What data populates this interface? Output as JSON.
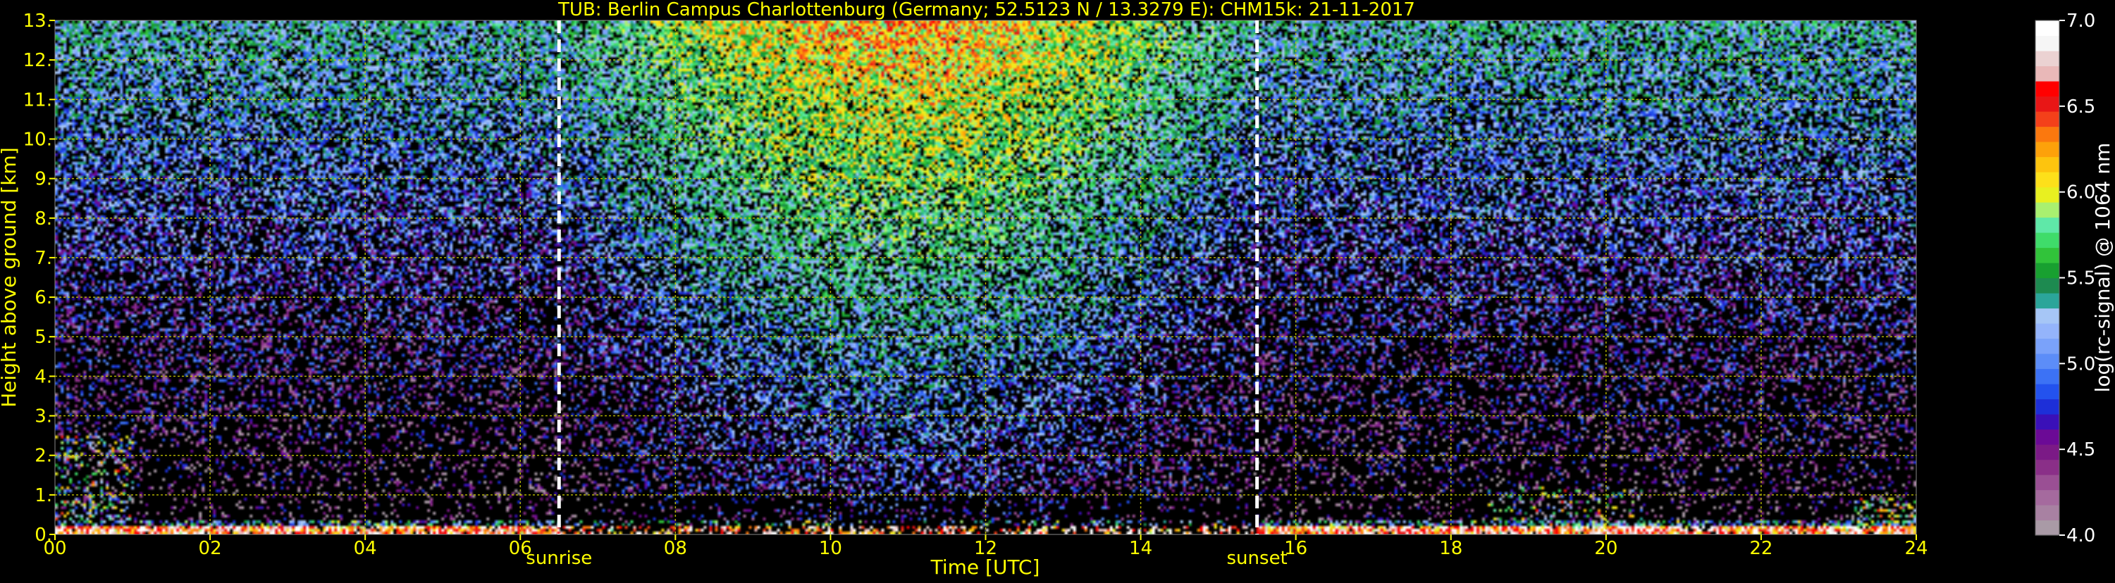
{
  "chart_data": {
    "type": "heatmap",
    "title": "TUB: Berlin Campus Charlottenburg (Germany; 52.5123 N / 13.3279 E):    CHM15k: 21-11-2017",
    "xlabel": "Time [UTC]",
    "ylabel": "Height above ground [km]",
    "xlim": [
      0,
      24
    ],
    "ylim": [
      0,
      13
    ],
    "x_ticks": [
      "00",
      "02",
      "04",
      "06",
      "08",
      "10",
      "12",
      "14",
      "16",
      "18",
      "20",
      "22",
      "24"
    ],
    "x_tick_values": [
      0,
      2,
      4,
      6,
      8,
      10,
      12,
      14,
      16,
      18,
      20,
      22,
      24
    ],
    "y_ticks": [
      "0.",
      "1.",
      "2.",
      "3.",
      "4.",
      "5.",
      "6.",
      "7.",
      "8.",
      "9.",
      "10.",
      "11.",
      "12.",
      "13."
    ],
    "y_tick_values": [
      0,
      1,
      2,
      3,
      4,
      5,
      6,
      7,
      8,
      9,
      10,
      11,
      12,
      13
    ],
    "grid": true,
    "annotations": [
      {
        "label": "sunrise",
        "x": 6.5
      },
      {
        "label": "sunset",
        "x": 15.5
      }
    ],
    "colorbar": {
      "label": "log(rc-signal) @ 1064 nm",
      "range": [
        4.0,
        7.0
      ],
      "ticks": [
        "4.0",
        "4.5",
        "5.0",
        "5.5",
        "6.0",
        "6.5",
        "7.0"
      ],
      "tick_values": [
        4.0,
        4.5,
        5.0,
        5.5,
        6.0,
        6.5,
        7.0
      ],
      "colors": [
        "#a99aa6",
        "#a881a2",
        "#a56a9e",
        "#9a4f94",
        "#8a2f88",
        "#7b1a86",
        "#6b0a96",
        "#3a10b8",
        "#1d2fd8",
        "#2352ee",
        "#3c72f5",
        "#5c8df8",
        "#7aa2fa",
        "#94b4fb",
        "#a6c6f6",
        "#2ba59a",
        "#1d8a50",
        "#18a030",
        "#31c33a",
        "#3fdc6a",
        "#5fe8a8",
        "#a9f070",
        "#e8f020",
        "#fde01a",
        "#fdc40e",
        "#fda10a",
        "#fb780e",
        "#f4401a",
        "#e81616",
        "#ff0000",
        "#e9b8b8",
        "#ebd2d2",
        "#f6f6f6",
        "#ffffff"
      ]
    }
  },
  "colors": {
    "text": "#ffff00",
    "grid": "#cccc00",
    "background": "#000000",
    "marker": "#ffffff"
  }
}
